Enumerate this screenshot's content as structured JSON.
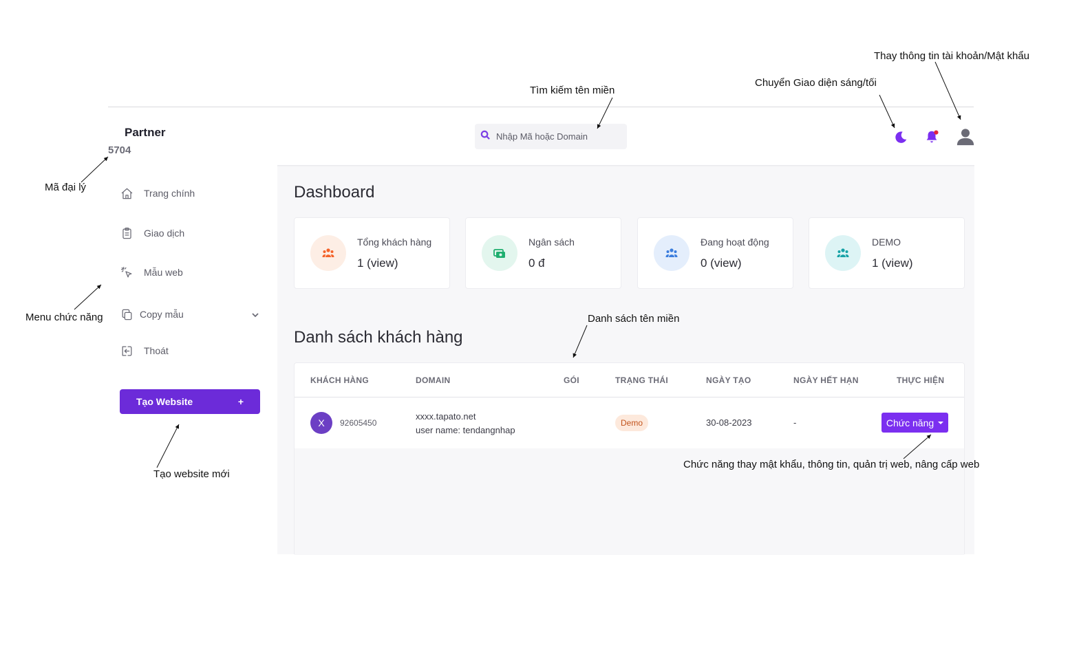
{
  "sidebar": {
    "brand": "Partner",
    "agent_code": "5704",
    "items": [
      {
        "label": "Trang chính",
        "icon": "home-icon"
      },
      {
        "label": "Giao dịch",
        "icon": "clipboard-icon"
      },
      {
        "label": "Mẫu web",
        "icon": "cursor-click-icon"
      },
      {
        "label": "Copy mẫu",
        "icon": "copy-icon"
      },
      {
        "label": "Thoát",
        "icon": "logout-icon"
      }
    ],
    "create_button": {
      "label": "Tạo Website",
      "plus": "+"
    }
  },
  "header": {
    "search_placeholder": "Nhập Mã hoặc Domain"
  },
  "dashboard": {
    "title": "Dashboard",
    "cards": [
      {
        "label": "Tổng khách hàng",
        "value": "1 (view)",
        "icon": "users-icon",
        "color": "#f4632a",
        "bg": "#fdeee5"
      },
      {
        "label": "Ngân sách",
        "value": "0 đ",
        "icon": "money-icon",
        "color": "#1fae6f",
        "bg": "#e3f6ee"
      },
      {
        "label": "Đang hoạt động",
        "value": "0 (view)",
        "icon": "users-icon",
        "color": "#3b7ddd",
        "bg": "#e4eefc"
      },
      {
        "label": "DEMO",
        "value": "1 (view)",
        "icon": "users-icon",
        "color": "#17a2a6",
        "bg": "#ddf4f5"
      }
    ]
  },
  "customers": {
    "title": "Danh sách khách hàng",
    "columns": [
      "KHÁCH HÀNG",
      "DOMAIN",
      "GÓI",
      "TRẠNG THÁI",
      "NGÀY TẠO",
      "NGÀY HẾT HẠN",
      "THỰC HIỆN"
    ],
    "rows": [
      {
        "avatar": "X",
        "id": "92605450",
        "domain": "xxxx.tapato.net",
        "username": "user name: tendangnhap",
        "package": "",
        "status": "Demo",
        "created": "30-08-2023",
        "expires": "-",
        "action": "Chức năng"
      }
    ]
  },
  "annotations": {
    "search": "Tìm kiếm tên miền",
    "theme": "Chuyển Giao diện sáng/tối",
    "account": "Thay thông tin tài khoản/Mật khẩu",
    "agent": "Mã đại lý",
    "menu": "Menu chức năng",
    "create": "Tạo website mới",
    "list": "Danh sách tên miền",
    "action": "Chức năng thay mật khẩu, thông tin, quản trị web, nâng cấp web"
  },
  "colors": {
    "accent": "#6c2bd9",
    "accent_button": "#7b2ff0",
    "notification_dot": "#e5243b"
  }
}
